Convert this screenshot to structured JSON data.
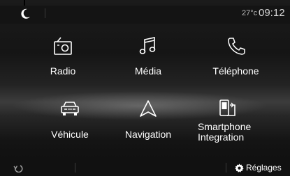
{
  "status": {
    "temperature": "27°c",
    "time": "09:12"
  },
  "menu": {
    "radio": "Radio",
    "media": "Média",
    "phone": "Téléphone",
    "vehicle": "Véhicule",
    "navigation": "Navigation",
    "smartphone_line1": "Smartphone",
    "smartphone_line2": "Integration"
  },
  "bottom": {
    "settings": "Réglages"
  },
  "icons": {
    "night_mode": "moon-icon",
    "radio": "radio-icon",
    "media": "music-note-icon",
    "phone": "phone-icon",
    "vehicle": "car-icon",
    "navigation": "navigation-arrow-icon",
    "smartphone": "smartphone-integration-icon",
    "back": "back-icon",
    "settings": "gear-icon"
  },
  "colors": {
    "background": "#141414",
    "text": "#ffffff",
    "status_text": "#d6d6d6"
  }
}
